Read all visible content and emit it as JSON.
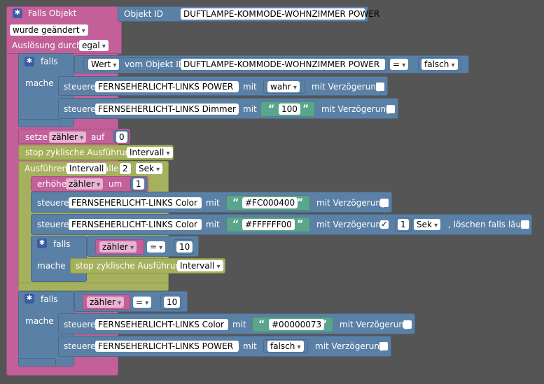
{
  "falls_objekt": {
    "title": "Falls Objekt",
    "objekt_id_label": "Objekt ID",
    "objekt_id_value": "DUFTLAMPE-KOMMODE-WOHNZIMMER POWER",
    "trigger_value": "wurde geändert",
    "ausloesung_label": "Auslösung durch",
    "ausloesung_value": "egal"
  },
  "falls1": {
    "if_label": "falls",
    "do_label": "mache",
    "wert_value": "Wert",
    "vom_objekt_label": "vom Objekt ID",
    "objekt_value": "DUFTLAMPE-KOMMODE-WOHNZIMMER POWER",
    "op": "=",
    "compare_value": "falsch",
    "row1": {
      "steuere": "steuere",
      "object": "FERNSEHERLICHT-LINKS POWER",
      "mit": "mit",
      "value": "wahr",
      "delay_label": "mit Verzögerung"
    },
    "row2": {
      "steuere": "steuere",
      "object": "FERNSEHERLICHT-LINKS  Dimmer",
      "mit": "mit",
      "value": "100",
      "delay_label": "mit Verzögerung"
    }
  },
  "setze": {
    "label": "setze",
    "var": "zähler",
    "auf": "auf",
    "value": "0"
  },
  "stop1": {
    "label": "stop zyklische Ausführung",
    "value": "Intervall"
  },
  "ausfuehren": {
    "label": "Ausführen",
    "name": "Intervall",
    "alle": "alle",
    "count": "2",
    "unit": "Sek"
  },
  "erhoehe": {
    "label": "erhöhe",
    "var": "zähler",
    "um": "um",
    "value": "1"
  },
  "row3": {
    "steuere": "steuere",
    "object": "FERNSEHERLICHT-LINKS  Color",
    "mit": "mit",
    "value": "#FC000400",
    "delay_label": "mit Verzögerung"
  },
  "row4": {
    "steuere": "steuere",
    "object": "FERNSEHERLICHT-LINKS  Color",
    "mit": "mit",
    "value": "#FFFFFF00",
    "delay_label": "mit Verzögerung",
    "check": "✓",
    "delay_count": "1",
    "delay_unit": "Sek",
    "clear_label": ", löschen falls läuft"
  },
  "falls2": {
    "if_label": "falls",
    "do_label": "mache",
    "var": "zähler",
    "op": "=",
    "value": "10",
    "stop_label": "stop zyklische Ausführung",
    "stop_value": "Intervall"
  },
  "falls3": {
    "if_label": "falls",
    "do_label": "mache",
    "var": "zähler",
    "op": "=",
    "value": "10",
    "row1": {
      "steuere": "steuere",
      "object": "FERNSEHERLICHT-LINKS  Color",
      "mit": "mit",
      "value": "#00000073",
      "delay_label": "mit Verzögerung"
    },
    "row2": {
      "steuere": "steuere",
      "object": "FERNSEHERLICHT-LINKS POWER",
      "mit": "mit",
      "value": "falsch",
      "delay_label": "mit Verzögerung"
    }
  },
  "colors": {
    "pink": "#c3609a",
    "blue": "#5b80a5",
    "olive": "#a5b15c",
    "teal": "#5ba58c",
    "background": "#555555"
  }
}
